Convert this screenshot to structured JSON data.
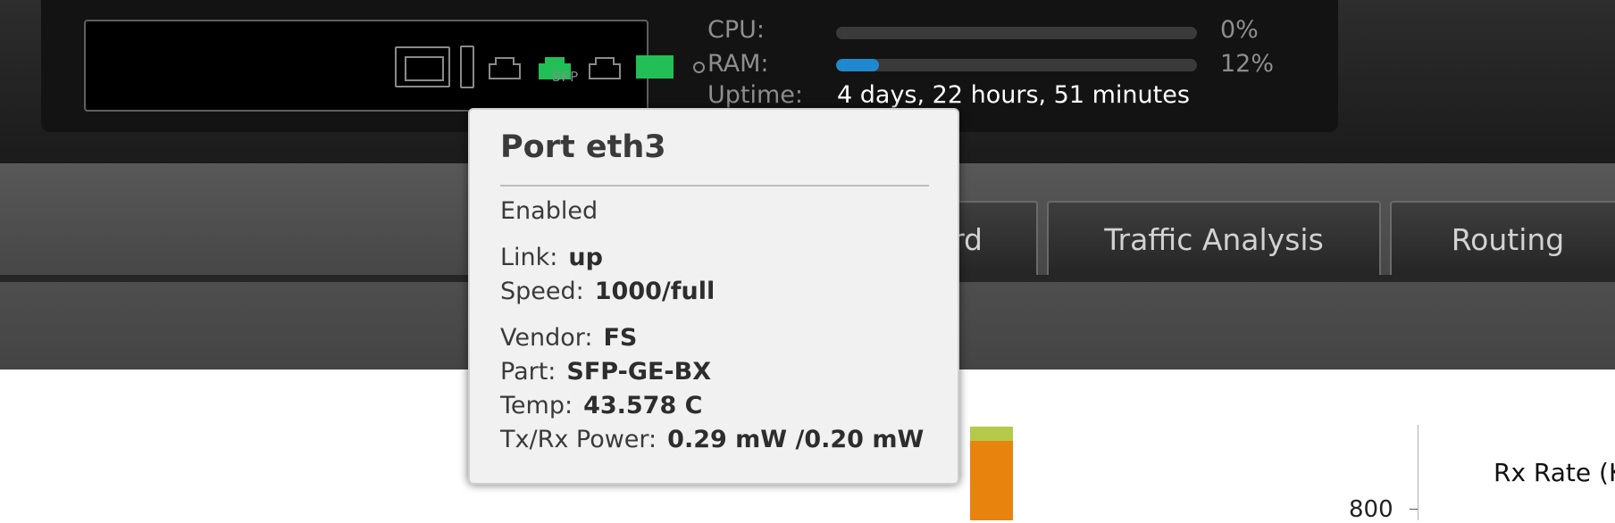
{
  "port_panel": {
    "sfp_label": "SFP",
    "active_port_color": "#22bf56",
    "icons": [
      "console-port-icon",
      "ethernet-port-icon",
      "sfp-port-icon",
      "led-indicator-icon"
    ]
  },
  "stats": {
    "cpu_label": "CPU:",
    "cpu_value": "0%",
    "cpu_fraction": 0.0,
    "ram_label": "RAM:",
    "ram_value": "12%",
    "ram_fraction": 0.12,
    "uptime_label": "Uptime:",
    "uptime_value": "4 days, 22 hours, 51 minutes",
    "bar_color": "#1f89cf"
  },
  "nav": {
    "tabs": [
      {
        "label": "Dashboard",
        "visible_text": "rd"
      },
      {
        "label": "Traffic Analysis"
      },
      {
        "label": "Routing"
      }
    ]
  },
  "tooltip": {
    "title": "Port eth3",
    "status": "Enabled",
    "link_label": "Link:",
    "link_value": "up",
    "speed_label": "Speed:",
    "speed_value": "1000/full",
    "vendor_label": "Vendor:",
    "vendor_value": "FS",
    "part_label": "Part:",
    "part_value": "SFP-GE-BX",
    "temp_label": "Temp:",
    "temp_value": "43.578 C",
    "power_label": "Tx/Rx Power:",
    "power_value": "0.29 mW /0.20 mW"
  },
  "chart": {
    "tick_label": "800",
    "legend_label": "Rx Rate (K",
    "colors": {
      "bar_main": "#e8830e",
      "bar_top": "#b4c94a"
    }
  }
}
